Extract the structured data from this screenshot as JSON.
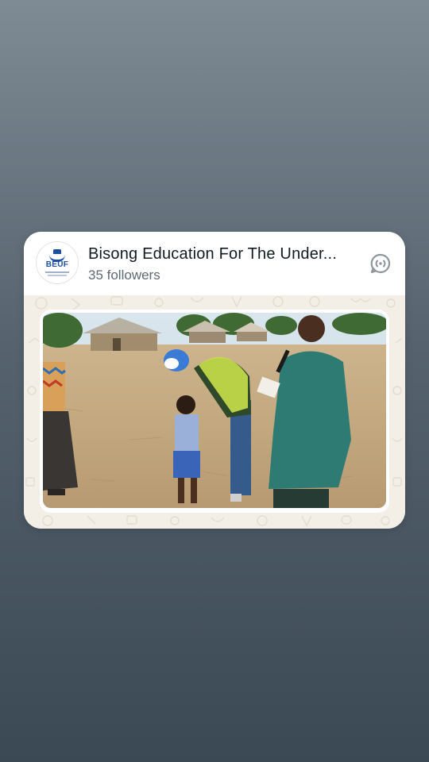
{
  "channel": {
    "name": "Bisong Education For The Under...",
    "followers": "35 followers",
    "avatar_icon": "beuf-logo",
    "avatar_text": "BEUF",
    "action_icon": "channel-forward-icon"
  },
  "post": {
    "image": "photo-outdoor-school-event"
  },
  "colors": {
    "background_top": "#7e8b95",
    "background_bottom": "#3b4955",
    "card_bg": "#ffffff",
    "media_bg": "#f3eee6",
    "title_text": "#111b21",
    "subtitle_text": "#5e6a72"
  }
}
